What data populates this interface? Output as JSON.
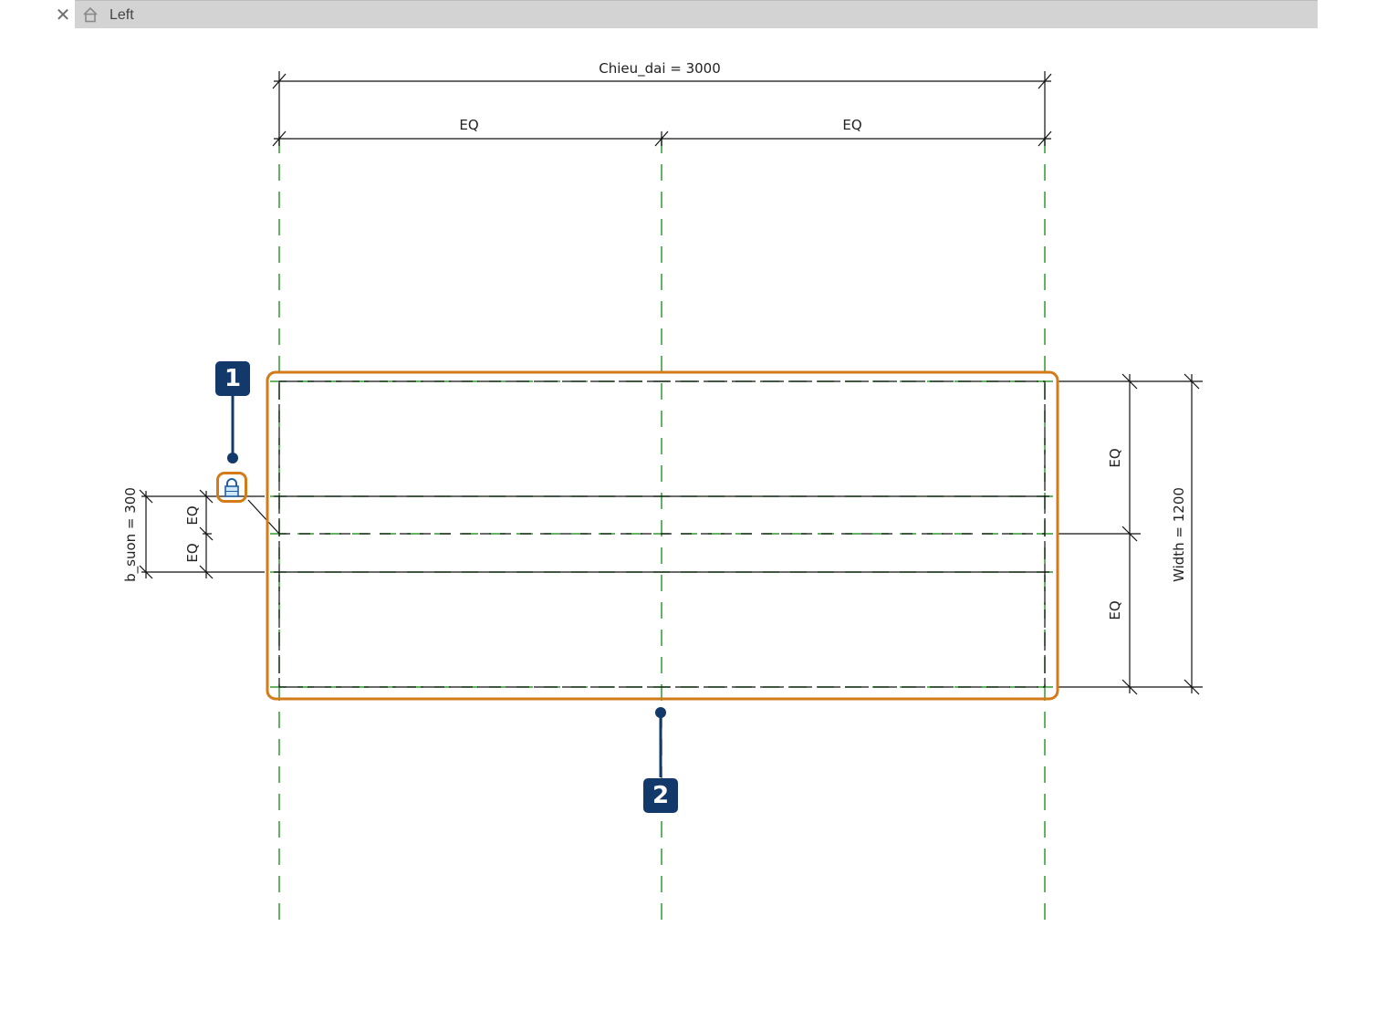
{
  "tab": {
    "close_icon": "close-icon",
    "home_icon": "home-icon",
    "title": "Left"
  },
  "dimensions": {
    "overall_length": "Chieu_dai = 3000",
    "eq_left": "EQ",
    "eq_right": "EQ",
    "eq_right_top": "EQ",
    "eq_right_bottom": "EQ",
    "width": "Width = 1200",
    "eq_left_top": "EQ",
    "eq_left_bottom": "EQ",
    "rib_width": "b_suon = 300"
  },
  "callouts": {
    "one": "1",
    "two": "2"
  },
  "colors": {
    "highlight": "#d37a19",
    "badge": "#13396b",
    "reference_plane": "#2e9a2e",
    "geometry": "#111111"
  },
  "icons": {
    "lock": "lock-icon"
  }
}
